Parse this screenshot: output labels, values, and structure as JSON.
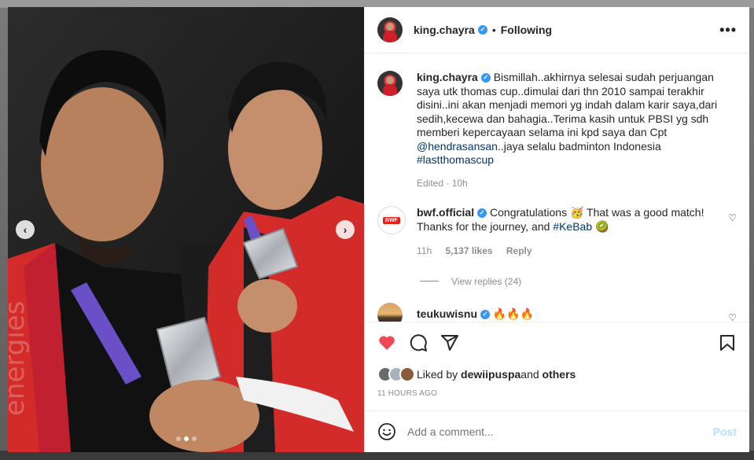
{
  "post": {
    "username": "king.chayra",
    "following_label": "Following",
    "bullet": "•",
    "more_icon": "more-horizontal-icon"
  },
  "caption": {
    "username": "king.chayra",
    "text_1": "Bismillah..akhirnya selesai sudah perjuangan saya utk thomas cup..dimulai dari thn 2010 sampai terakhir disini..ini akan menjadi memori yg indah dalam karir saya,dari sedih,kecewa dan bahagia..Terima kasih untuk PBSI yg sdh memberi kepercayaan selama ini kpd saya dan Cpt ",
    "mention": "@hendrasansan",
    "text_2": "..jaya selalu badminton Indonesia ",
    "hashtag": "#lastthomascup",
    "meta": "Edited · 10h"
  },
  "comments": [
    {
      "username": "bwf.official",
      "avatar_text": "BWF",
      "text_1": "Congratulations ",
      "emoji_1": "🥳",
      "text_2": " That was a good match! Thanks for the journey, and ",
      "hashtag": "#KeBab",
      "emoji_2": "🥝",
      "time": "11h",
      "likes": "5,137 likes",
      "reply": "Reply",
      "view_replies": "View replies (24)"
    },
    {
      "username": "teukuwisnu",
      "text": "🔥🔥🔥"
    }
  ],
  "likes": {
    "prefix": "Liked by ",
    "user": "dewiipuspa",
    "mid": " and ",
    "others": "others"
  },
  "timestamp": "11 HOURS AGO",
  "add_comment": {
    "placeholder": "Add a comment...",
    "post_label": "Post"
  },
  "colors": {
    "like_red": "#ed4956",
    "verified_blue": "#3897f0",
    "link_blue": "#00376b",
    "post_disabled": "#b2dffc"
  }
}
